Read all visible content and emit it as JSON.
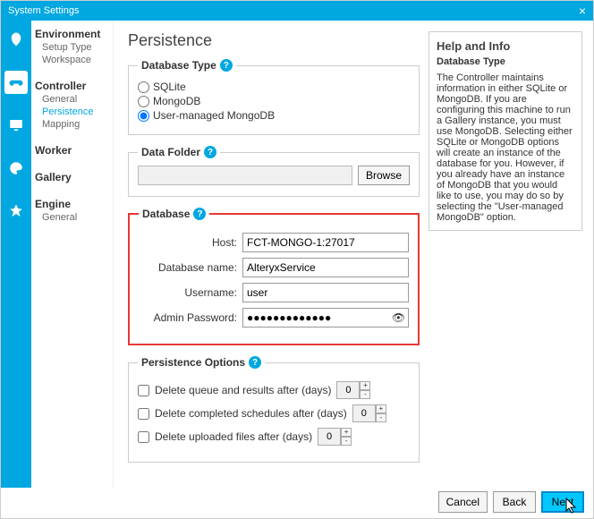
{
  "window": {
    "title": "System Settings"
  },
  "nav": {
    "groups": [
      {
        "title": "Environment",
        "subs": [
          "Setup Type",
          "Workspace"
        ]
      },
      {
        "title": "Controller",
        "subs": [
          "General",
          "Persistence",
          "Mapping"
        ],
        "active": "Persistence"
      },
      {
        "title": "Worker",
        "subs": []
      },
      {
        "title": "Gallery",
        "subs": []
      },
      {
        "title": "Engine",
        "subs": [
          "General"
        ]
      }
    ]
  },
  "page": {
    "title": "Persistence"
  },
  "dbtype": {
    "legend": "Database Type",
    "options": [
      "SQLite",
      "MongoDB",
      "User-managed MongoDB"
    ],
    "selected": "User-managed MongoDB"
  },
  "datafolder": {
    "legend": "Data Folder",
    "value": "",
    "browse": "Browse"
  },
  "database": {
    "legend": "Database",
    "host_label": "Host:",
    "host": "FCT-MONGO-1:27017",
    "name_label": "Database name:",
    "name": "AlteryxService",
    "user_label": "Username:",
    "user": "user",
    "pw_label": "Admin Password:",
    "pw": "●●●●●●●●●●●●●"
  },
  "persist": {
    "legend": "Persistence Options",
    "opt1": "Delete queue and results after (days)",
    "opt2": "Delete completed schedules after (days)",
    "opt3": "Delete uploaded files after (days)",
    "val": "0"
  },
  "help": {
    "title": "Help and Info",
    "subtitle": "Database Type",
    "body": "The Controller maintains information in either SQLite or MongoDB. If you are configuring this machine to run a Gallery instance, you must use MongoDB. Selecting either SQLite or MongoDB options will create an instance of the database for you. However, if you already have an instance of MongoDB that you would like to use, you may do so by selecting the \"User-managed MongoDB\" option."
  },
  "footer": {
    "cancel": "Cancel",
    "back": "Back",
    "next": "Next"
  }
}
